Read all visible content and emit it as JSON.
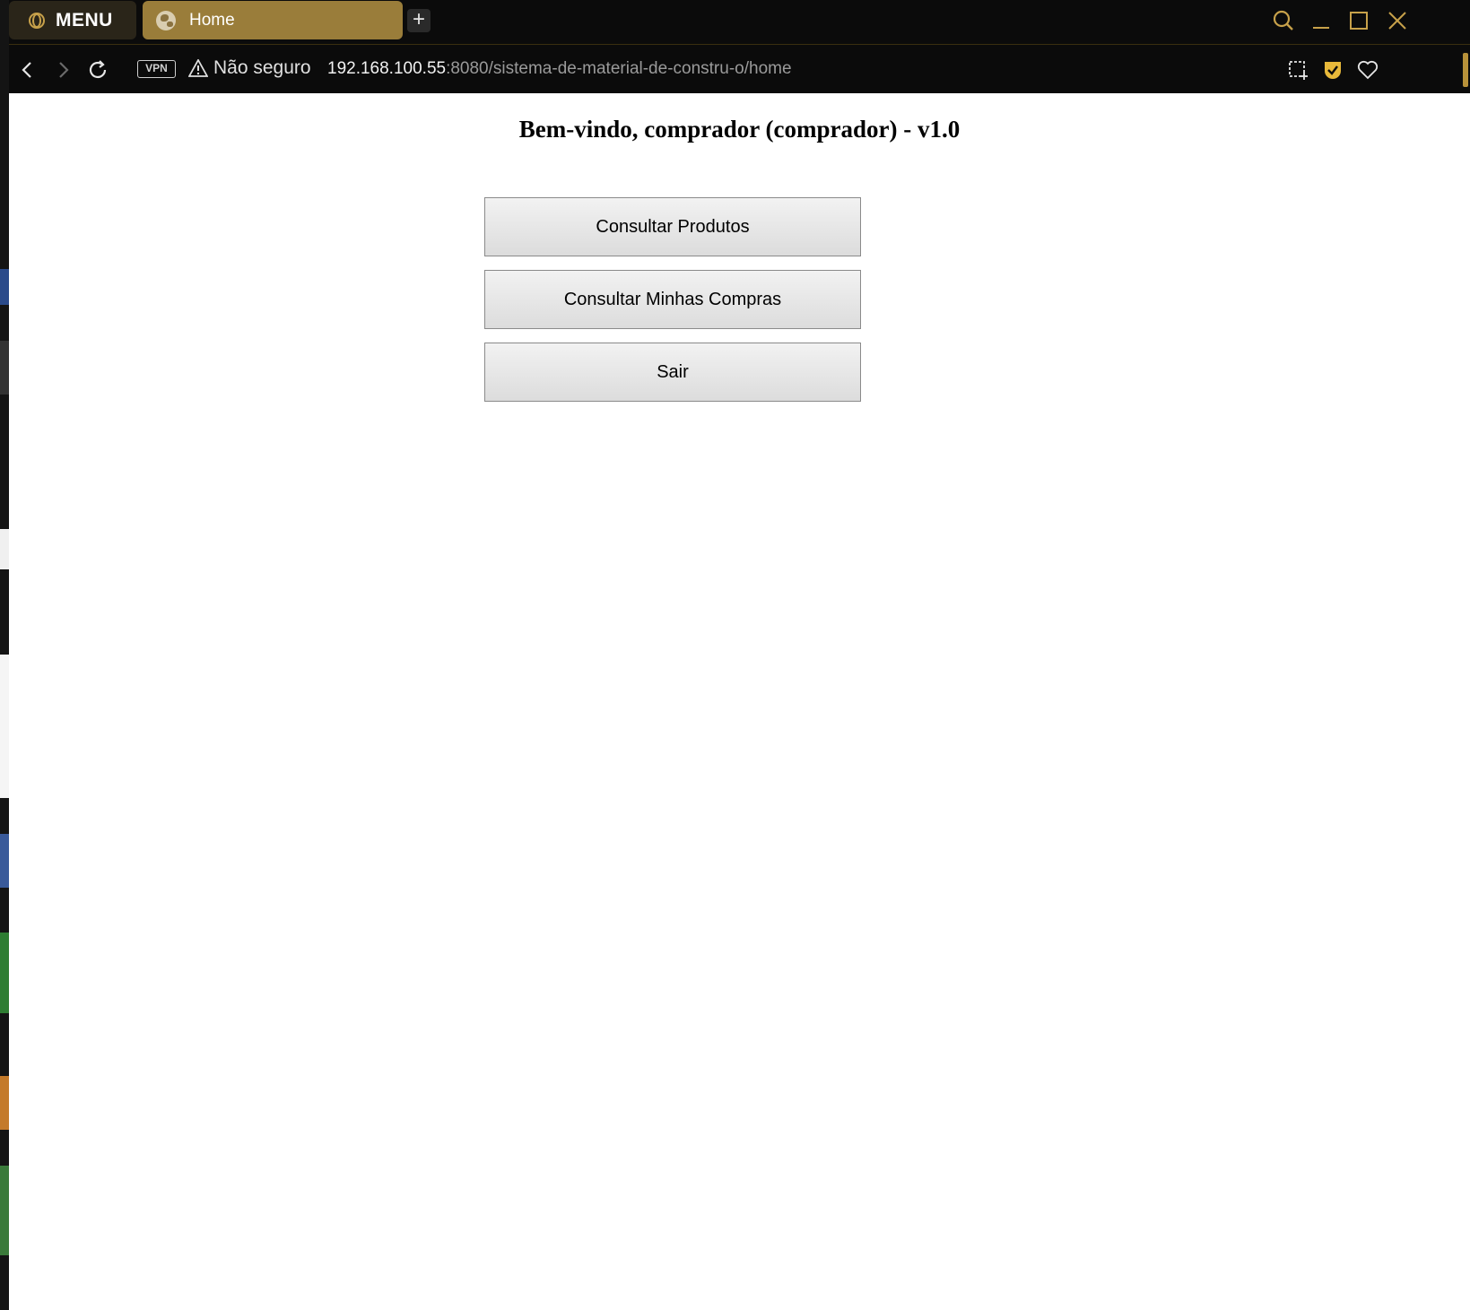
{
  "browser": {
    "menu_label": "MENU",
    "tabs": [
      {
        "label": "Home",
        "active": true
      }
    ],
    "new_tab_label": "+",
    "address": {
      "vpn_label": "VPN",
      "security_label": "Não seguro",
      "url_host": "192.168.100.55",
      "url_path": ":8080/sistema-de-material-de-constru-o/home"
    },
    "colors": {
      "accent": "#c7a14a",
      "active_tab": "#9a7d3a",
      "chrome_bg": "#0b0b0b"
    }
  },
  "page": {
    "title": "Bem-vindo, comprador (comprador) - v1.0",
    "buttons": [
      {
        "label": "Consultar Produtos"
      },
      {
        "label": "Consultar Minhas Compras"
      },
      {
        "label": "Sair"
      }
    ]
  }
}
